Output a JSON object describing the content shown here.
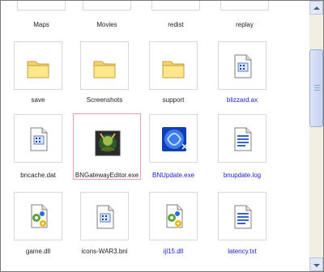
{
  "rows": [
    {
      "items": [
        {
          "name": "Maps",
          "type": "folder",
          "link": false
        },
        {
          "name": "Movies",
          "type": "folder",
          "link": false
        },
        {
          "name": "redist",
          "type": "folder",
          "link": false
        },
        {
          "name": "replay",
          "type": "folder",
          "link": false
        }
      ]
    },
    {
      "items": [
        {
          "name": "save",
          "type": "folder",
          "link": false
        },
        {
          "name": "Screenshots",
          "type": "folder",
          "link": false
        },
        {
          "name": "support",
          "type": "folder",
          "link": false
        },
        {
          "name": "blizzard.ax",
          "type": "system-file",
          "link": true
        }
      ]
    },
    {
      "items": [
        {
          "name": "bncache.dat",
          "type": "system-file",
          "link": false
        },
        {
          "name": "BNGatewayEditor.exe",
          "type": "exe-gateway-editor",
          "link": false,
          "selected": true
        },
        {
          "name": "BNUpdate.exe",
          "type": "exe-bnupdate",
          "link": true
        },
        {
          "name": "bnupdate.log",
          "type": "text-file",
          "link": true
        }
      ]
    },
    {
      "items": [
        {
          "name": "game.dll",
          "type": "dll-file",
          "link": false
        },
        {
          "name": "icons-WAR3.bni",
          "type": "system-file",
          "link": false
        },
        {
          "name": "ijl15.dll",
          "type": "dll-file",
          "link": true
        },
        {
          "name": "latency.txt",
          "type": "text-file",
          "link": true
        }
      ]
    }
  ],
  "colors": {
    "link": "#1a1ad0",
    "selection_border": "#e8a0a8",
    "tile_border": "#d7d7d7"
  }
}
